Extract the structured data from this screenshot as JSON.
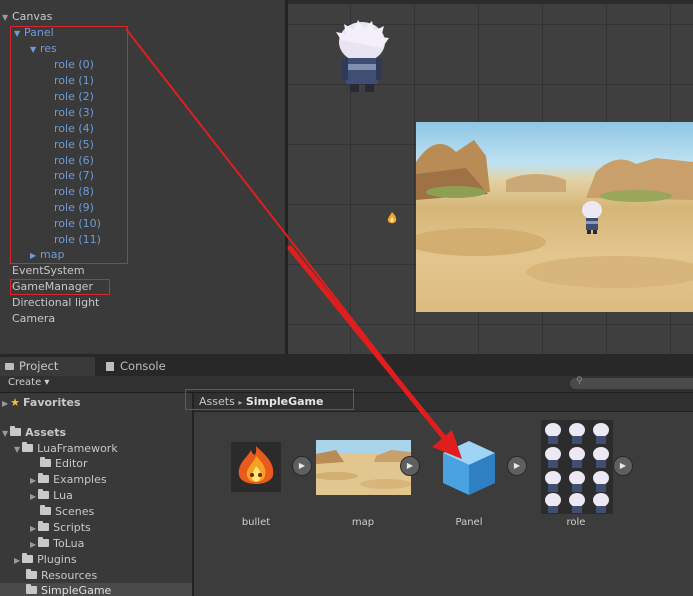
{
  "hierarchy": {
    "items": [
      {
        "label": "Canvas"
      },
      {
        "label": "Panel"
      },
      {
        "label": "res"
      },
      {
        "label": "role (0)"
      },
      {
        "label": "role (1)"
      },
      {
        "label": "role (2)"
      },
      {
        "label": "role (3)"
      },
      {
        "label": "role (4)"
      },
      {
        "label": "role (5)"
      },
      {
        "label": "role (6)"
      },
      {
        "label": "role (7)"
      },
      {
        "label": "role (8)"
      },
      {
        "label": "role (9)"
      },
      {
        "label": "role (10)"
      },
      {
        "label": "role (11)"
      },
      {
        "label": "map"
      },
      {
        "label": "EventSystem"
      },
      {
        "label": "GameManager"
      },
      {
        "label": "Directional light"
      },
      {
        "label": "Camera"
      }
    ]
  },
  "tabs": {
    "project": "Project",
    "console": "Console"
  },
  "project_toolbar": {
    "create_label": "Create ▾"
  },
  "tree": {
    "favorites": "Favorites",
    "assets": "Assets",
    "items": [
      {
        "label": "LuaFramework"
      },
      {
        "label": "Editor"
      },
      {
        "label": "Examples"
      },
      {
        "label": "Lua"
      },
      {
        "label": "Scenes"
      },
      {
        "label": "Scripts"
      },
      {
        "label": "ToLua"
      },
      {
        "label": "Plugins"
      },
      {
        "label": "Resources"
      },
      {
        "label": "SimpleGame"
      }
    ]
  },
  "breadcrumb": {
    "root": "Assets",
    "separator": "▸",
    "current": "SimpleGame"
  },
  "assets": [
    {
      "label": "bullet",
      "icon": "fire-icon"
    },
    {
      "label": "map",
      "icon": "desert-map-thumbnail"
    },
    {
      "label": "Panel",
      "icon": "prefab-cube-icon"
    },
    {
      "label": "role",
      "icon": "character-sprite-sheet"
    }
  ],
  "colors": {
    "annotation": "#d9262b",
    "selected_text": "#6f9bd8",
    "prefab_blue": "#4aa3e0"
  }
}
